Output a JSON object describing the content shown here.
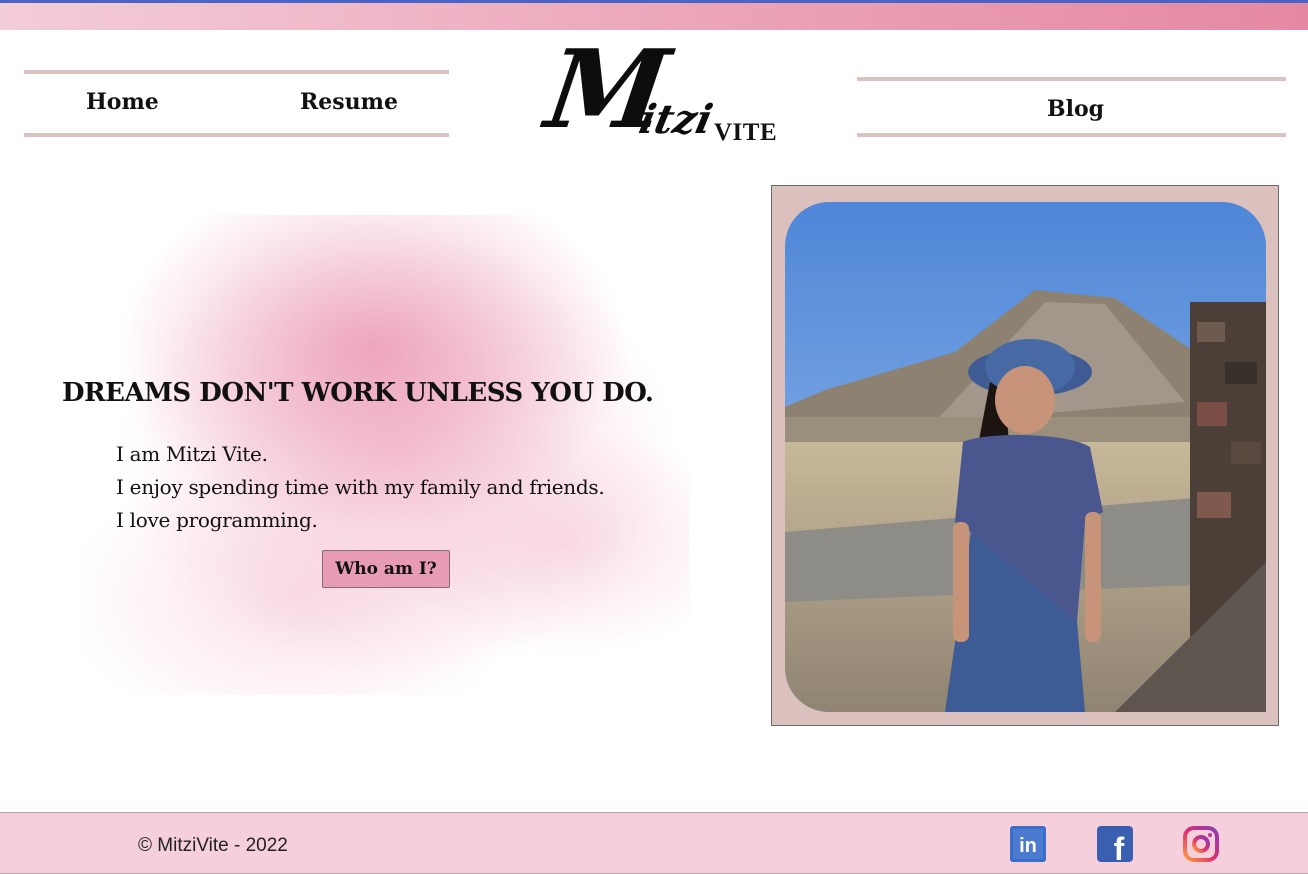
{
  "nav": {
    "home_label": "Home",
    "resume_label": "Resume",
    "blog_label": "Blog"
  },
  "logo": {
    "script_m": "M",
    "script_rest": "itzi",
    "surname": "VITE"
  },
  "hero": {
    "headline": "DREAMS DON'T WORK UNLESS YOU DO.",
    "bio_lines": [
      "I am Mitzi Vite.",
      "I enjoy spending time with my family and friends.",
      "I love programming."
    ],
    "cta_label": "Who am I?"
  },
  "footer": {
    "copyright": "© MitziVite - 2022",
    "social": [
      {
        "icon": "linkedin-icon",
        "glyph": "in",
        "color": "#3b6ec9"
      },
      {
        "icon": "facebook-icon",
        "glyph": "f",
        "color": "#3b5fb0"
      },
      {
        "icon": "instagram-icon",
        "glyph": "",
        "color": "#e1306c"
      }
    ]
  },
  "colors": {
    "accent_pink": "#e79bb4",
    "nav_rule": "#d9c2c0",
    "photo_frame": "#dbc1bd",
    "footer_bg": "#f5cfdc",
    "top_border": "#4a63c9"
  }
}
